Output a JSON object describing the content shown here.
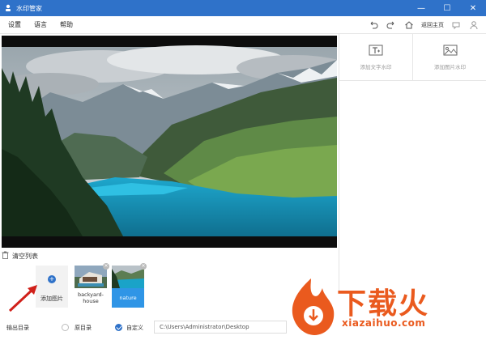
{
  "window": {
    "title": "水印管家",
    "minimize": "—",
    "maximize": "☐",
    "close": "✕"
  },
  "menu": {
    "items": [
      "设置",
      "语言",
      "帮助"
    ]
  },
  "toolbar": {
    "undo_icon": "undo-icon",
    "redo_icon": "redo-icon",
    "home_label": "返回主页"
  },
  "side_tools": [
    {
      "label": "添加文字水印",
      "icon": "text-watermark-icon"
    },
    {
      "label": "添加图片水印",
      "icon": "image-watermark-icon"
    }
  ],
  "list": {
    "clear_label": "清空列表",
    "add_label": "添加图片",
    "thumbnails": [
      {
        "caption": "backyard-house",
        "selected": false
      },
      {
        "caption": "nature",
        "selected": true
      }
    ]
  },
  "output": {
    "label": "输出目录",
    "option_original": "原目录",
    "option_custom": "自定义",
    "path": "C:\\Users\\Administrator\\Desktop"
  },
  "watermark": {
    "big": "下载火",
    "url": "xiazaihuo.com"
  },
  "colors": {
    "accent": "#2f72c9",
    "watermark": "#ea5a1e",
    "lake": "#1aa3c8"
  }
}
